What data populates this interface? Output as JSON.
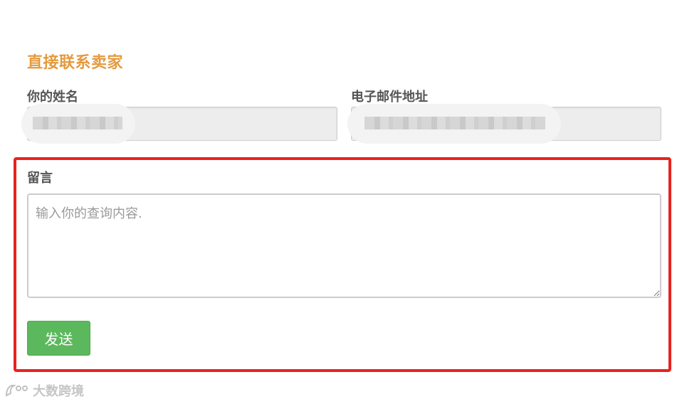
{
  "contact": {
    "title": "直接联系卖家",
    "name_label": "你的姓名",
    "email_label": "电子邮件地址",
    "message_label": "留言",
    "message_placeholder": "输入你的查询内容.",
    "send_label": "发送"
  },
  "highlight": {
    "color": "#e8231f"
  },
  "watermark": {
    "text": "大数跨境"
  },
  "colors": {
    "title": "#e49a3e",
    "send_button": "#5cb85c"
  }
}
